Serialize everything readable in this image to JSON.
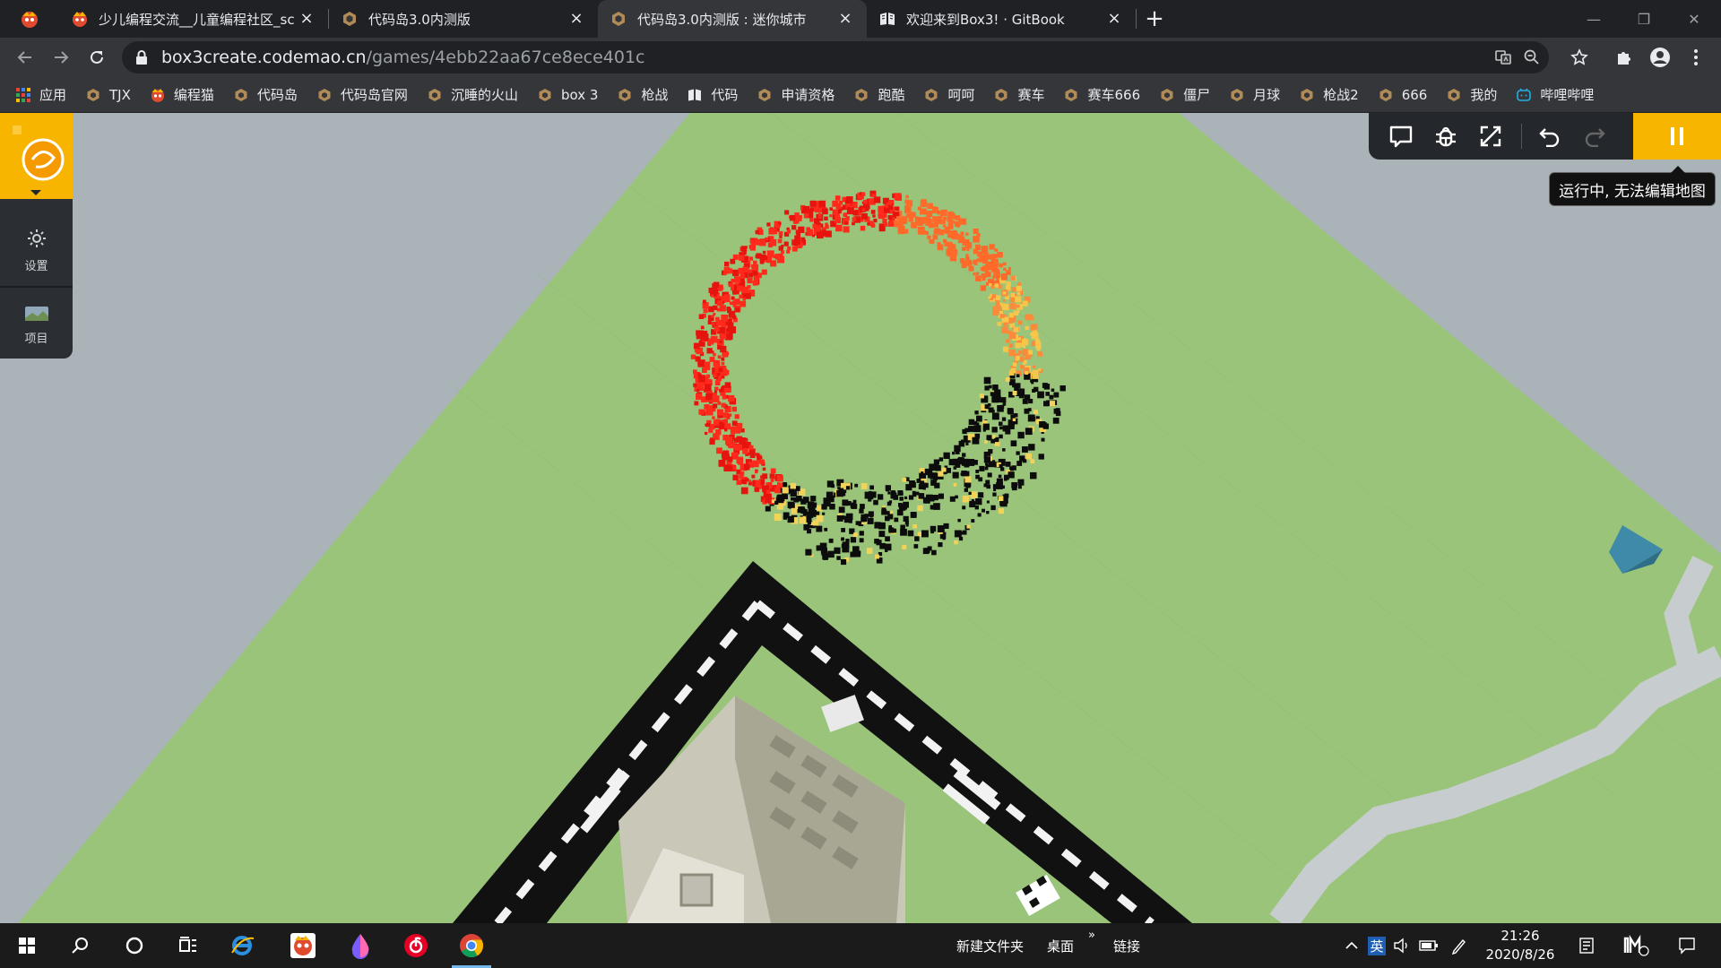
{
  "browser": {
    "tabs": [
      {
        "title": "少儿编程交流__儿童编程社区_sc",
        "close": "×",
        "active": false
      },
      {
        "title": "代码岛3.0内测版",
        "close": "×",
        "active": false
      },
      {
        "title": "代码岛3.0内测版 : 迷你城市",
        "close": "×",
        "active": true
      },
      {
        "title": "欢迎来到Box3! · GitBook",
        "close": "×",
        "active": false
      }
    ],
    "new_tab": "+",
    "url_host": "box3create.codemao.cn",
    "url_path": "/games/4ebb22aa67ce8ece401c",
    "window_controls": [
      "—",
      "❐",
      "✕"
    ]
  },
  "bookmarks": [
    {
      "label": "应用",
      "icon": "apps-grid-icon"
    },
    {
      "label": "TJX",
      "icon": "box3-icon"
    },
    {
      "label": "编程猫",
      "icon": "codemao-icon"
    },
    {
      "label": "代码岛",
      "icon": "box3-icon"
    },
    {
      "label": "代码岛官网",
      "icon": "box3-icon"
    },
    {
      "label": "沉睡的火山",
      "icon": "box3-icon"
    },
    {
      "label": "box 3",
      "icon": "box3-icon"
    },
    {
      "label": "枪战",
      "icon": "box3-icon"
    },
    {
      "label": "代码",
      "icon": "gitbook-icon"
    },
    {
      "label": "申请资格",
      "icon": "box3-icon"
    },
    {
      "label": "跑酷",
      "icon": "box3-icon"
    },
    {
      "label": "呵呵",
      "icon": "box3-icon"
    },
    {
      "label": "赛车",
      "icon": "box3-icon"
    },
    {
      "label": "赛车666",
      "icon": "box3-icon"
    },
    {
      "label": "僵尸",
      "icon": "box3-icon"
    },
    {
      "label": "月球",
      "icon": "box3-icon"
    },
    {
      "label": "枪战2",
      "icon": "box3-icon"
    },
    {
      "label": "666",
      "icon": "box3-icon"
    },
    {
      "label": "我的",
      "icon": "box3-icon"
    },
    {
      "label": "哔哩哔哩",
      "icon": "bilibili-icon"
    }
  ],
  "editor": {
    "side_items": [
      {
        "label": "设置",
        "icon": "gear-icon"
      },
      {
        "label": "项目",
        "icon": "project-thumbnail-icon"
      }
    ],
    "toolbar_icons": [
      "chat-icon",
      "debug-icon",
      "fullscreen-icon",
      "undo-icon",
      "redo-icon",
      "pause-icon"
    ],
    "tooltip": "运行中, 无法编辑地图"
  },
  "taskbar": {
    "desktop_items": [
      "新建文件夹",
      "桌面",
      "链接"
    ],
    "desktop_chevron": "»",
    "time": "21:26",
    "date": "2020/8/26",
    "ime_label": "英"
  },
  "colors": {
    "accent": "#f7b500",
    "grass": "#99c47a",
    "chrome_dark": "#202124",
    "chrome_toolbar": "#35363a"
  }
}
